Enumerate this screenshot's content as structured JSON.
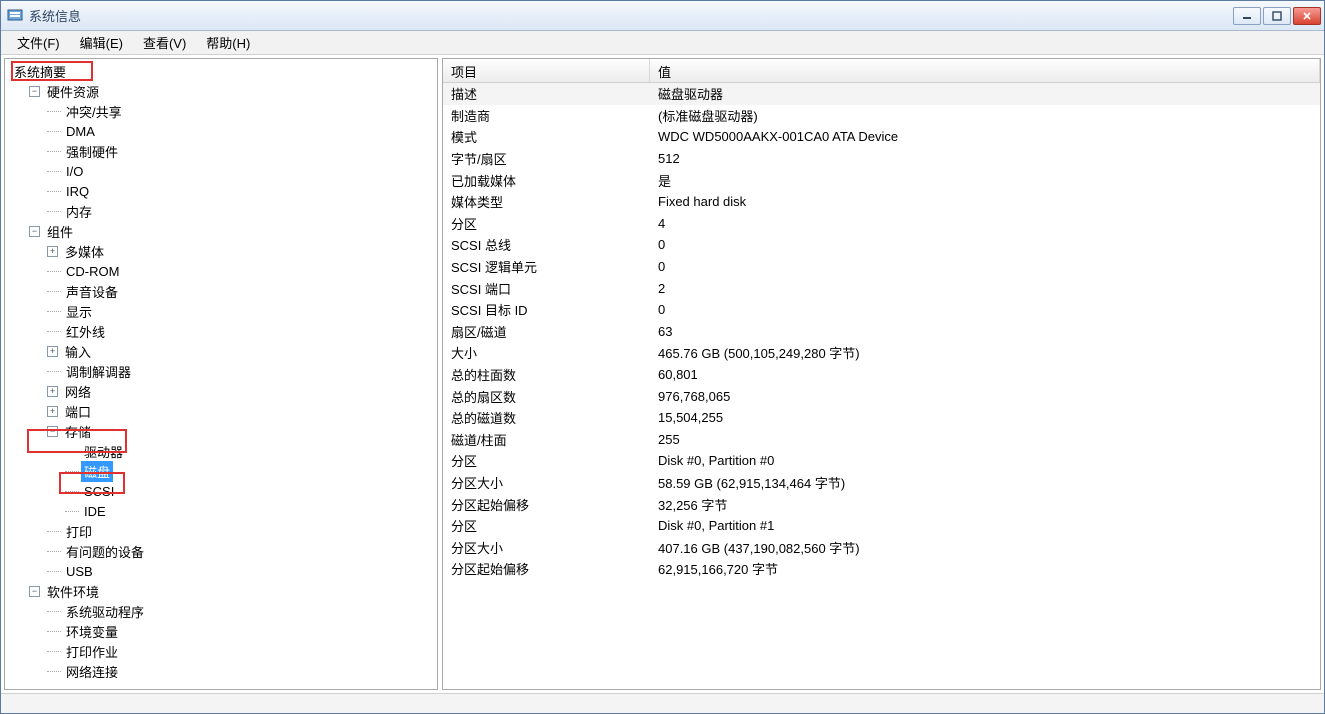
{
  "window": {
    "title": "系统信息"
  },
  "menu": {
    "file": "文件(F)",
    "edit": "编辑(E)",
    "view": "查看(V)",
    "help": "帮助(H)"
  },
  "tree": {
    "root": "系统摘要",
    "hw": {
      "label": "硬件资源",
      "conflict": "冲突/共享",
      "dma": "DMA",
      "forced": "强制硬件",
      "io": "I/O",
      "irq": "IRQ",
      "mem": "内存"
    },
    "comp": {
      "label": "组件",
      "mm": "多媒体",
      "cdrom": "CD-ROM",
      "sound": "声音设备",
      "display": "显示",
      "ir": "红外线",
      "input": "输入",
      "modem": "调制解调器",
      "network": "网络",
      "port": "端口",
      "storage": {
        "label": "存储",
        "drives": "驱动器",
        "disk": "磁盘",
        "scsi": "SCSI",
        "ide": "IDE"
      },
      "print": "打印",
      "problem": "有问题的设备",
      "usb": "USB"
    },
    "sw": {
      "label": "软件环境",
      "drv": "系统驱动程序",
      "env": "环境变量",
      "pj": "打印作业",
      "nc": "网络连接"
    }
  },
  "list": {
    "headers": {
      "item": "项目",
      "value": "值"
    },
    "rows": [
      {
        "item": "描述",
        "value": "磁盘驱动器"
      },
      {
        "item": "制造商",
        "value": "(标准磁盘驱动器)"
      },
      {
        "item": "模式",
        "value": "WDC WD5000AAKX-001CA0 ATA Device"
      },
      {
        "item": "字节/扇区",
        "value": "512"
      },
      {
        "item": "已加载媒体",
        "value": "是"
      },
      {
        "item": "媒体类型",
        "value": "Fixed hard disk"
      },
      {
        "item": "分区",
        "value": "4"
      },
      {
        "item": "SCSI 总线",
        "value": "0"
      },
      {
        "item": "SCSI 逻辑单元",
        "value": "0"
      },
      {
        "item": "SCSI 端口",
        "value": "2"
      },
      {
        "item": "SCSI 目标 ID",
        "value": "0"
      },
      {
        "item": "扇区/磁道",
        "value": "63"
      },
      {
        "item": "大小",
        "value": "465.76 GB (500,105,249,280 字节)"
      },
      {
        "item": "总的柱面数",
        "value": "60,801"
      },
      {
        "item": "总的扇区数",
        "value": "976,768,065"
      },
      {
        "item": "总的磁道数",
        "value": "15,504,255"
      },
      {
        "item": "磁道/柱面",
        "value": "255"
      },
      {
        "item": "分区",
        "value": "Disk #0, Partition #0"
      },
      {
        "item": "分区大小",
        "value": "58.59 GB (62,915,134,464 字节)"
      },
      {
        "item": "分区起始偏移",
        "value": "32,256 字节"
      },
      {
        "item": "分区",
        "value": "Disk #0, Partition #1"
      },
      {
        "item": "分区大小",
        "value": "407.16 GB (437,190,082,560 字节)"
      },
      {
        "item": "分区起始偏移",
        "value": "62,915,166,720 字节"
      }
    ]
  },
  "bottom": {
    "partial": ""
  }
}
